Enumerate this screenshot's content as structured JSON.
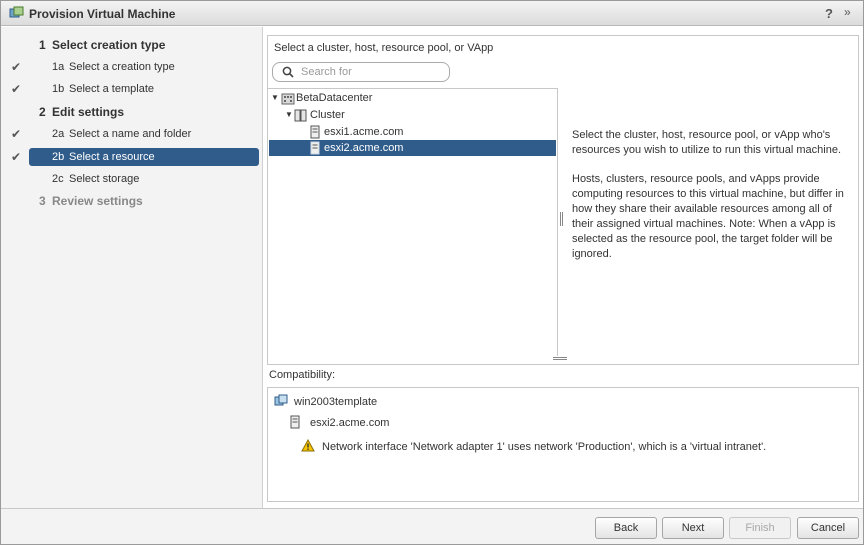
{
  "window": {
    "title": "Provision Virtual Machine",
    "help": "?",
    "expand": "»"
  },
  "steps": [
    {
      "num": "1",
      "label": "Select creation type"
    },
    {
      "num": "2",
      "label": "Edit settings"
    },
    {
      "num": "3",
      "label": "Review settings"
    }
  ],
  "substeps": [
    {
      "num": "1a",
      "label": "Select a creation type",
      "done": true
    },
    {
      "num": "1b",
      "label": "Select a template",
      "done": true
    },
    {
      "num": "2a",
      "label": "Select a name and folder",
      "done": true
    },
    {
      "num": "2b",
      "label": "Select a resource",
      "done": true,
      "active": true
    },
    {
      "num": "2c",
      "label": "Select storage",
      "done": false
    }
  ],
  "main": {
    "prompt": "Select a cluster, host, resource pool, or VApp",
    "search_placeholder": "Search for",
    "tree": {
      "datacenter": "BetaDatacenter",
      "cluster": "Cluster",
      "host1": "esxi1.acme.com",
      "host2": "esxi2.acme.com"
    },
    "help": {
      "p1": "Select the cluster, host, resource pool, or vApp who's resources you wish to utilize to run this virtual machine.",
      "p2": "Hosts, clusters, resource pools, and vApps provide computing resources to this virtual machine, but differ in how they share their available resources among all of their assigned virtual machines.  Note: When a vApp is selected as the resource pool, the target folder will be ignored."
    }
  },
  "compatibility": {
    "label": "Compatibility:",
    "template": "win2003template",
    "host": "esxi2.acme.com",
    "warning": "Network interface 'Network adapter 1' uses network 'Production', which is a 'virtual intranet'."
  },
  "footer": {
    "back": "Back",
    "next": "Next",
    "finish": "Finish",
    "cancel": "Cancel"
  },
  "colors": {
    "selection": "#2f5c8a",
    "warning": "#f5c400"
  }
}
